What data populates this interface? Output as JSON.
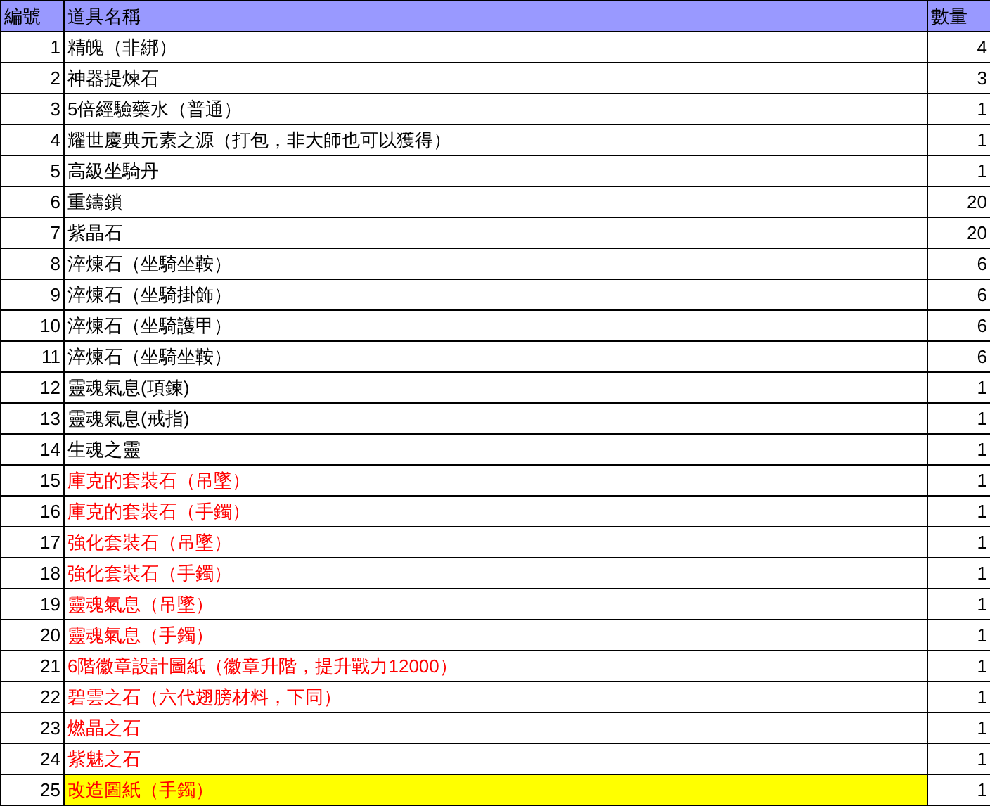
{
  "table": {
    "columns": [
      "編號",
      "道具名稱",
      "數量"
    ],
    "rows": [
      {
        "no": "1",
        "name": "精魄（非綁）",
        "qty": "4",
        "color": "#000000",
        "highlighted": false
      },
      {
        "no": "2",
        "name": "神器提煉石",
        "qty": "3",
        "color": "#000000",
        "highlighted": false
      },
      {
        "no": "3",
        "name": "5倍經驗藥水（普通）",
        "qty": "1",
        "color": "#000000",
        "highlighted": false
      },
      {
        "no": "4",
        "name": "耀世慶典元素之源（打包，非大師也可以獲得）",
        "qty": "1",
        "color": "#000000",
        "highlighted": false
      },
      {
        "no": "5",
        "name": "高級坐騎丹",
        "qty": "1",
        "color": "#000000",
        "highlighted": false
      },
      {
        "no": "6",
        "name": "重鑄鎖",
        "qty": "20",
        "color": "#000000",
        "highlighted": false
      },
      {
        "no": "7",
        "name": "紫晶石",
        "qty": "20",
        "color": "#000000",
        "highlighted": false
      },
      {
        "no": "8",
        "name": "淬煉石（坐騎坐鞍）",
        "qty": "6",
        "color": "#000000",
        "highlighted": false
      },
      {
        "no": "9",
        "name": "淬煉石（坐騎掛飾）",
        "qty": "6",
        "color": "#000000",
        "highlighted": false
      },
      {
        "no": "10",
        "name": "淬煉石（坐騎護甲）",
        "qty": "6",
        "color": "#000000",
        "highlighted": false
      },
      {
        "no": "11",
        "name": "淬煉石（坐騎坐鞍）",
        "qty": "6",
        "color": "#000000",
        "highlighted": false
      },
      {
        "no": "12",
        "name": "靈魂氣息(項鍊)",
        "qty": "1",
        "color": "#000000",
        "highlighted": false
      },
      {
        "no": "13",
        "name": "靈魂氣息(戒指)",
        "qty": "1",
        "color": "#000000",
        "highlighted": false
      },
      {
        "no": "14",
        "name": "生魂之靈",
        "qty": "1",
        "color": "#000000",
        "highlighted": false
      },
      {
        "no": "15",
        "name": "庫克的套裝石（吊墜）",
        "qty": "1",
        "color": "#ff0000",
        "highlighted": false
      },
      {
        "no": "16",
        "name": "庫克的套裝石（手鐲）",
        "qty": "1",
        "color": "#ff0000",
        "highlighted": false
      },
      {
        "no": "17",
        "name": "強化套裝石（吊墜）",
        "qty": "1",
        "color": "#ff0000",
        "highlighted": false
      },
      {
        "no": "18",
        "name": "強化套裝石（手鐲）",
        "qty": "1",
        "color": "#ff0000",
        "highlighted": false
      },
      {
        "no": "19",
        "name": "靈魂氣息（吊墜）",
        "qty": "1",
        "color": "#ff0000",
        "highlighted": false
      },
      {
        "no": "20",
        "name": "靈魂氣息（手鐲）",
        "qty": "1",
        "color": "#ff0000",
        "highlighted": false
      },
      {
        "no": "21",
        "name": "6階徽章設計圖紙（徽章升階，提升戰力12000）",
        "qty": "1",
        "color": "#ff0000",
        "highlighted": false
      },
      {
        "no": "22",
        "name": "碧雲之石（六代翅膀材料，下同）",
        "qty": "1",
        "color": "#ff0000",
        "highlighted": false
      },
      {
        "no": "23",
        "name": "燃晶之石",
        "qty": "1",
        "color": "#ff0000",
        "highlighted": false
      },
      {
        "no": "24",
        "name": "紫魅之石",
        "qty": "1",
        "color": "#ff0000",
        "highlighted": false
      },
      {
        "no": "25",
        "name": "改造圖紙（手鐲）",
        "qty": "1",
        "color": "#ff0000",
        "highlighted": true
      }
    ]
  }
}
